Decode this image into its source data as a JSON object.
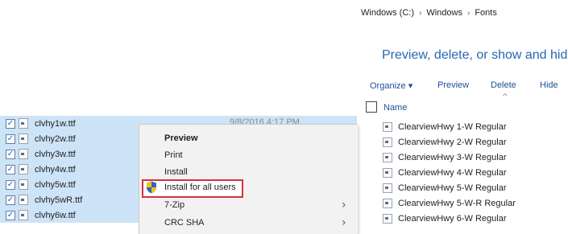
{
  "file_list": {
    "rows": [
      {
        "name": "clvhy1w.ttf",
        "checked": true,
        "date": "9/8/2016 4:17 PM"
      },
      {
        "name": "clvhy2w.ttf",
        "checked": true
      },
      {
        "name": "clvhy3w.ttf",
        "checked": true
      },
      {
        "name": "clvhy4w.ttf",
        "checked": true
      },
      {
        "name": "clvhy5w.ttf",
        "checked": true
      },
      {
        "name": "clvhy5wR.ttf",
        "checked": true
      },
      {
        "name": "clvhy6w.ttf",
        "checked": true
      }
    ],
    "checkmark": "✓"
  },
  "context_menu": {
    "items": [
      {
        "label": "Preview",
        "bold": true
      },
      {
        "label": "Print"
      },
      {
        "label": "Install"
      },
      {
        "label": "Install for all users",
        "icon": "shield-icon",
        "highlighted": true
      },
      {
        "label": "7-Zip",
        "submenu": true
      },
      {
        "label": "CRC SHA",
        "submenu": true
      }
    ],
    "submenu_arrow": "›"
  },
  "fonts_folder": {
    "breadcrumb": [
      "Windows (C:)",
      "Windows",
      "Fonts"
    ],
    "breadcrumb_separator": "›",
    "heading": "Preview, delete, or show and hide",
    "toolbar": {
      "organize": "Organize ▾",
      "preview": "Preview",
      "delete": "Delete",
      "hide": "Hide"
    },
    "sort_indicator": "^",
    "column_header": "Name",
    "fonts": [
      "ClearviewHwy 1-W Regular",
      "ClearviewHwy 2-W Regular",
      "ClearviewHwy 3-W Regular",
      "ClearviewHwy 4-W Regular",
      "ClearviewHwy 5-W Regular",
      "ClearviewHwy 5-W-R Regular",
      "ClearviewHwy 6-W Regular"
    ]
  },
  "colors": {
    "selection": "#cde3f7",
    "menu_background": "#f2f2f2",
    "highlight_border": "#d0343a",
    "heading_blue": "#2867b2",
    "link_blue": "#1e4f99"
  }
}
